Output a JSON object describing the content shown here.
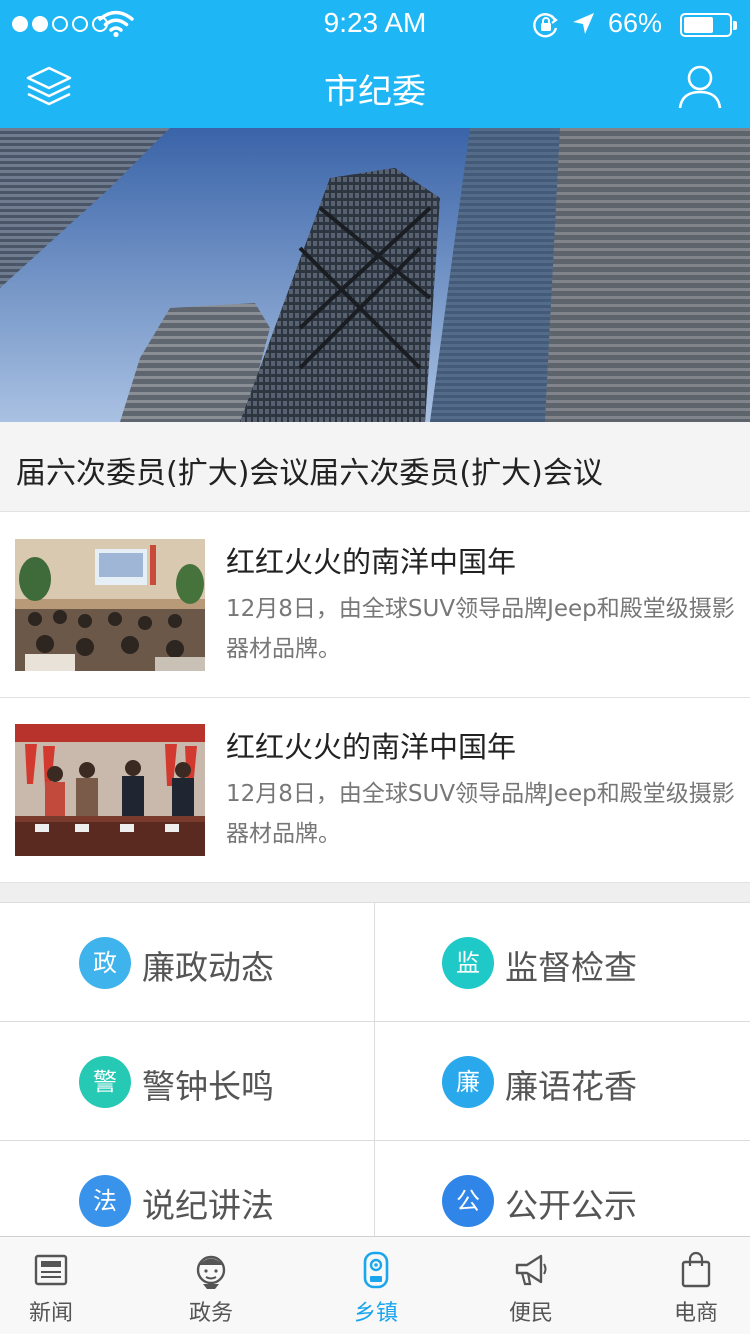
{
  "status_bar": {
    "time": "9:23 AM",
    "battery_percent_label": "66%",
    "battery_level": 0.66,
    "signal_bars_filled": 2,
    "signal_bars_total": 5,
    "icons": [
      "signal-dots-icon",
      "wifi-icon",
      "rotation-lock-icon",
      "location-arrow-icon",
      "battery-icon"
    ]
  },
  "nav": {
    "title": "市纪委",
    "left_icon": "layers-icon",
    "right_icon": "user-icon"
  },
  "theme": {
    "header_color": "#1fb6f5",
    "tab_active_color": "#1aa6ec"
  },
  "banner": {
    "caption": "届六次委员(扩大)会议届六次委员(扩大)会议"
  },
  "news": [
    {
      "title": "红红火火的南洋中国年",
      "description": "12月8日，由全球SUV领导品牌Jeep和殿堂级摄影器材品牌。"
    },
    {
      "title": "红红火火的南洋中国年",
      "description": "12月8日，由全球SUV领导品牌Jeep和殿堂级摄影器材品牌。"
    }
  ],
  "categories": [
    {
      "badge": "政",
      "label": "廉政动态",
      "color": "#3fb3ec"
    },
    {
      "badge": "监",
      "label": "监督检查",
      "color": "#1fc9c8"
    },
    {
      "badge": "警",
      "label": "警钟长鸣",
      "color": "#26c9b4"
    },
    {
      "badge": "廉",
      "label": "廉语花香",
      "color": "#29a9ec"
    },
    {
      "badge": "法",
      "label": "说纪讲法",
      "color": "#3a93ea"
    },
    {
      "badge": "公",
      "label": "公开公示",
      "color": "#2f86e8"
    }
  ],
  "tabs": [
    {
      "label": "新闻",
      "icon": "newspaper-icon",
      "active": false
    },
    {
      "label": "政务",
      "icon": "official-icon",
      "active": false
    },
    {
      "label": "乡镇",
      "icon": "town-icon",
      "active": true
    },
    {
      "label": "便民",
      "icon": "megaphone-icon",
      "active": false
    },
    {
      "label": "电商",
      "icon": "shopping-bag-icon",
      "active": false
    }
  ]
}
